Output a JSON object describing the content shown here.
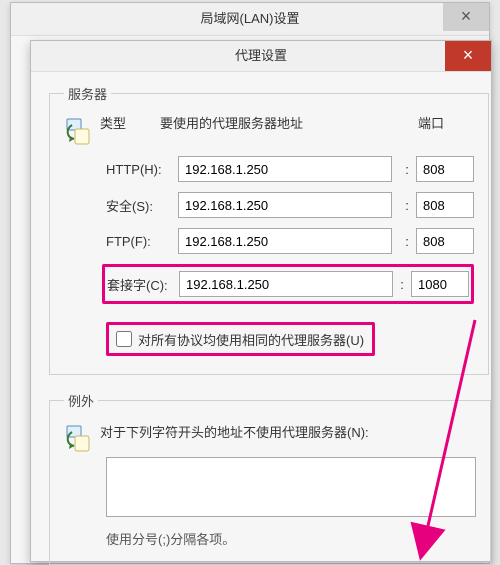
{
  "parent_window": {
    "title": "局域网(LAN)设置",
    "close_glyph": "×"
  },
  "dialog": {
    "title": "代理设置",
    "close_glyph": "×"
  },
  "servers_group": {
    "legend": "服务器",
    "col_type": "类型",
    "col_addr": "要使用的代理服务器地址",
    "col_port": "端口",
    "rows": {
      "http": {
        "label": "HTTP(H):",
        "addr": "192.168.1.250",
        "port": "808"
      },
      "secure": {
        "label": "安全(S):",
        "addr": "192.168.1.250",
        "port": "808"
      },
      "ftp": {
        "label": "FTP(F):",
        "addr": "192.168.1.250",
        "port": "808"
      },
      "socks": {
        "label": "套接字(C):",
        "addr": "192.168.1.250",
        "port": "1080"
      }
    },
    "same_for_all": "对所有协议均使用相同的代理服务器(U)"
  },
  "exceptions_group": {
    "legend": "例外",
    "label": "对于下列字符开头的地址不使用代理服务器(N):",
    "value": "",
    "hint": "使用分号(;)分隔各项。"
  },
  "colon": ":"
}
